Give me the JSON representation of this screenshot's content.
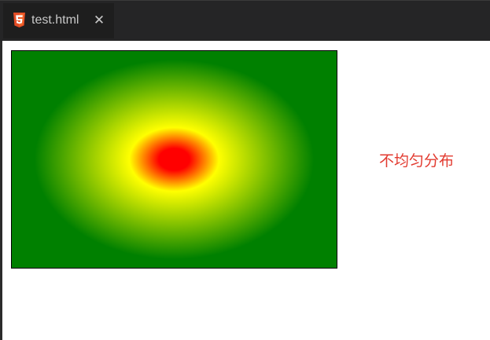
{
  "tab": {
    "file_name": "test.html",
    "close_symbol": "✕",
    "file_icon": "html5-icon",
    "close_icon": "close-icon"
  },
  "page": {
    "side_label": "不均匀分布",
    "side_label_color": "#e23a2f",
    "gradient": {
      "kind": "radial",
      "shape": "ellipse",
      "colors": [
        "#ff0000",
        "#ffff00",
        "#008000"
      ]
    }
  },
  "colors": {
    "tabbar_background": "#252526",
    "active_tab_background": "#1e1e1e",
    "html5_orange": "#e44d26"
  }
}
